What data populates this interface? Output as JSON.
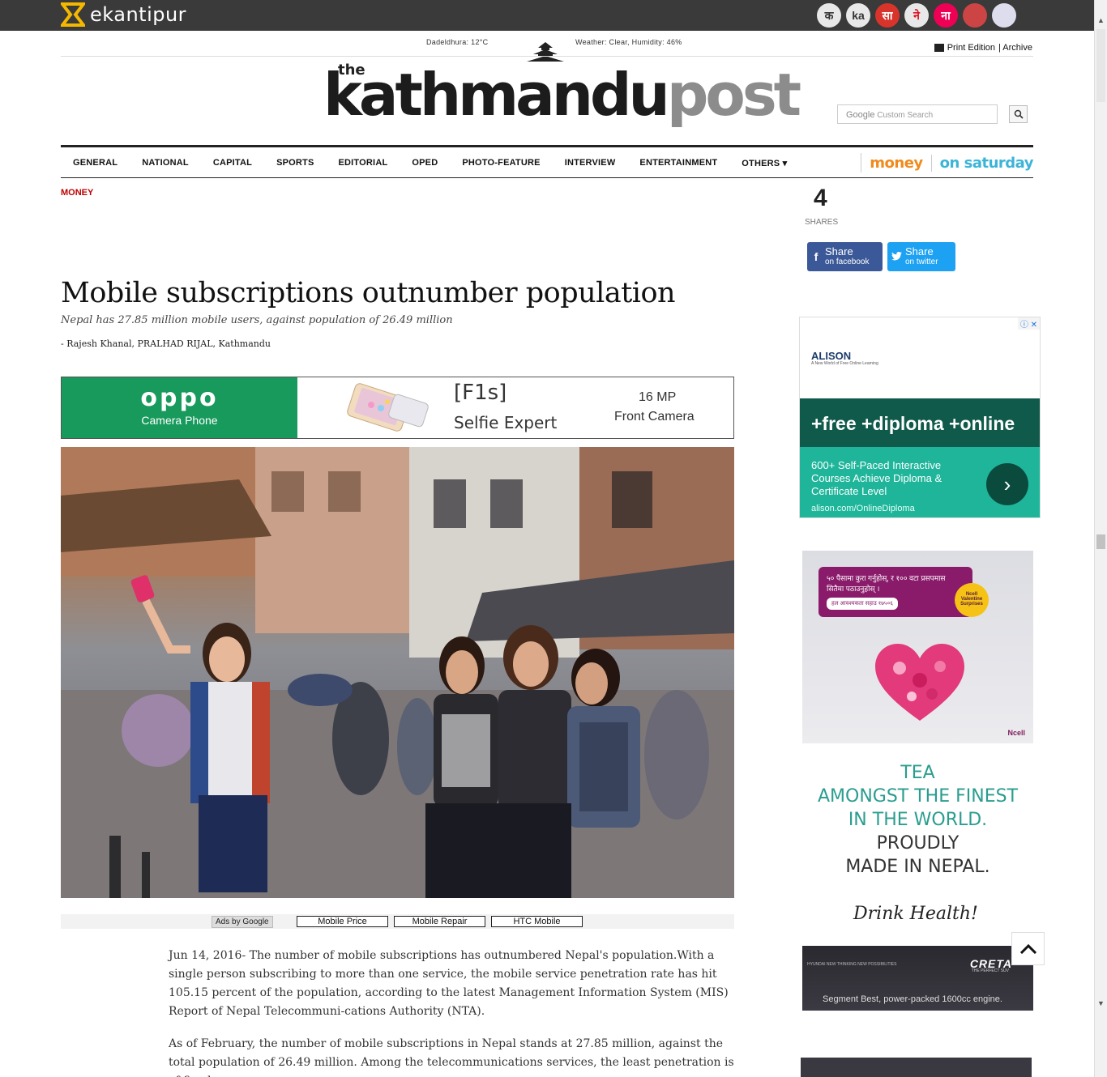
{
  "topbar": {
    "brand": "ekantipur",
    "sister_sites": [
      "क",
      "ka",
      "सा",
      "ने",
      "ना",
      "",
      ""
    ]
  },
  "header": {
    "weather_city": "Dadeldhura: 12°C",
    "weather_status": "Weather: Clear, Humidity: 46%",
    "logo_the": "the",
    "logo_main": "kathmandu",
    "logo_post": "post",
    "print_edition": "Print Edition",
    "archive": "| Archive",
    "search_placeholder": "Custom Search",
    "search_brand": "Google"
  },
  "nav": {
    "items": [
      "GENERAL",
      "NATIONAL",
      "CAPITAL",
      "SPORTS",
      "EDITORIAL",
      "OPED",
      "PHOTO-FEATURE",
      "INTERVIEW",
      "ENTERTAINMENT",
      "OTHERS"
    ],
    "others_caret": "▾",
    "money": "money",
    "on_saturday": "on saturday"
  },
  "article": {
    "category": "MONEY",
    "title": "Mobile subscriptions outnumber population",
    "subtitle": "Nepal has 27.85 million mobile users, against population of 26.49 million",
    "byline": "- Rajesh Khanal, PRALHAD RIJAL, Kathmandu",
    "paragraph_1": "Jun 14, 2016- The number of mobile subscriptions has outnumbered Nepal's population.With a single person subscribing to more than one service, the mobile service penetration rate has hit 105.15 percent of the population, according to the latest Management Information System (MIS) Report of Nepal Telecommuni-cations Authority (NTA).",
    "paragraph_2": "As of February, the number of mobile subscriptions in Nepal stands at 27.85 million, against the total population of 26.49 million. Among the telecommunications services, the least penetration is of fixed"
  },
  "share": {
    "count": "4",
    "label": "SHARES",
    "facebook_big": "Share",
    "facebook_small": "on facebook",
    "twitter_big": "Share",
    "twitter_small": "on twitter"
  },
  "oppo_ad": {
    "brand": "oppo",
    "sub": "Camera Phone",
    "model": "[F1s]",
    "tagline": "Selfie Expert",
    "mp": "16 MP",
    "cam": "Front Camera"
  },
  "google_ads": {
    "label": "Ads by Google",
    "links": [
      "Mobile Price",
      "Mobile Repair",
      "HTC Mobile"
    ]
  },
  "sidebar": {
    "alison_brand": "ALISON",
    "alison_tag": "A New World of Free Online Learning",
    "alison_headline": "+free +diploma +online",
    "alison_desc": "600+ Self-Paced Interactive Courses Achieve Diploma & Certificate Level",
    "alison_url": "alison.com/OnlineDiploma",
    "ncell_text": "५० पैसामा कुरा गर्नुहोस्, र १०० वटा प्रसपमास सितैमा पठाउनुहोस् ।",
    "ncell_sub": "हल आवश्यकता सहाउ १७५०६",
    "ncell_badge": "Ncell Valentine Surprises",
    "ncell_logo": "Ncell",
    "tea_l1": "TEA",
    "tea_l2": "AMONGST THE FINEST",
    "tea_l3": "IN THE WORLD.",
    "tea_l4": "PROUDLY",
    "tea_l5": "MADE IN NEPAL.",
    "drink": "Drink Health!",
    "creta_logo": "CRETA",
    "creta_sub": "THE PERFECT SUV",
    "creta_text": "Segment Best, power-packed 1600cc engine.",
    "creta_mini": "HYUNDAI NEW THINKING NEW POSSIBILITIES"
  },
  "colors": {
    "topbar": "#3a3a3a",
    "category": "#bb0000",
    "money": "#f08a1c",
    "on_saturday": "#3cb4d8",
    "facebook": "#3b5998",
    "twitter": "#1da1f2",
    "oppo_green": "#179a5c",
    "alison_dark": "#0f5a4a",
    "alison_teal": "#1fb59a"
  }
}
